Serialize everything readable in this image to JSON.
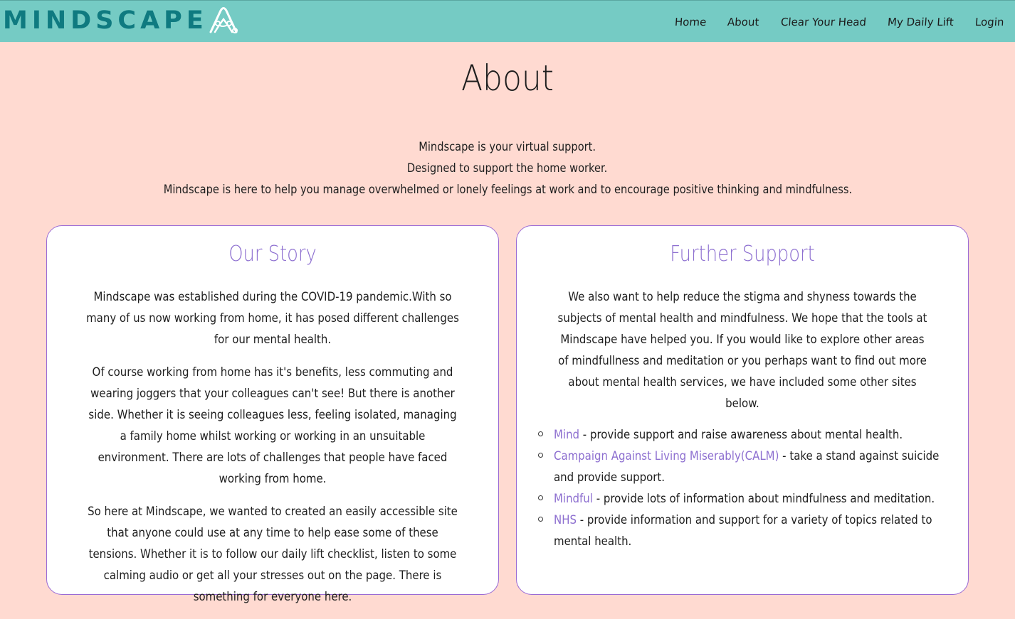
{
  "nav": {
    "brand": "MINDSCAPE",
    "links": [
      "Home",
      "About",
      "Clear Your Head",
      "My Daily Lift",
      "Login"
    ]
  },
  "page": {
    "title": "About",
    "intro": [
      "Mindscape is your virtual support.",
      "Designed to support the home worker.",
      "Mindscape is here to help you manage overwhelmed or lonely feelings at work and to encourage positive thinking and mindfulness."
    ]
  },
  "our_story": {
    "heading": "Our Story",
    "paragraphs": [
      "Mindscape was established during the COVID-19 pandemic.With so many of us now working from home, it has posed different challenges for our mental health.",
      "Of course working from home has it's benefits, less commuting and wearing joggers that your colleagues can't see! But there is another side. Whether it is seeing colleagues less, feeling isolated, managing a family home whilst working or working in an unsuitable environment. There are lots of challenges that people have faced working from home.",
      "So here at Mindscape, we wanted to created an easily accessible site that anyone could use at any time to help ease some of these tensions. Whether it is to follow our daily lift checklist, listen to some calming audio or get all your stresses out on the page. There is something for everyone here."
    ]
  },
  "further_support": {
    "heading": "Further Support",
    "intro": "We also want to help reduce the stigma and shyness towards the subjects of mental health and mindfulness. We hope that the tools at Mindscape have helped you. If you would like to explore other areas of mindfullness and meditation or you perhaps want to find out more about mental health services, we have included some other sites below.",
    "links": [
      {
        "name": "Mind",
        "desc": " - provide support and raise awareness about mental health."
      },
      {
        "name": "Campaign Against Living Miserably(CALM)",
        "desc": " - take a stand against suicide and provide support."
      },
      {
        "name": "Mindful",
        "desc": " - provide lots of information about mindfulness and meditation."
      },
      {
        "name": "NHS",
        "desc": " - provide information and support for a variety of topics related to mental health."
      }
    ]
  },
  "colors": {
    "nav_bg": "#75cbc4",
    "page_bg": "#ffdad1",
    "brand": "#0f7a80",
    "accent": "#8d6fd0"
  }
}
